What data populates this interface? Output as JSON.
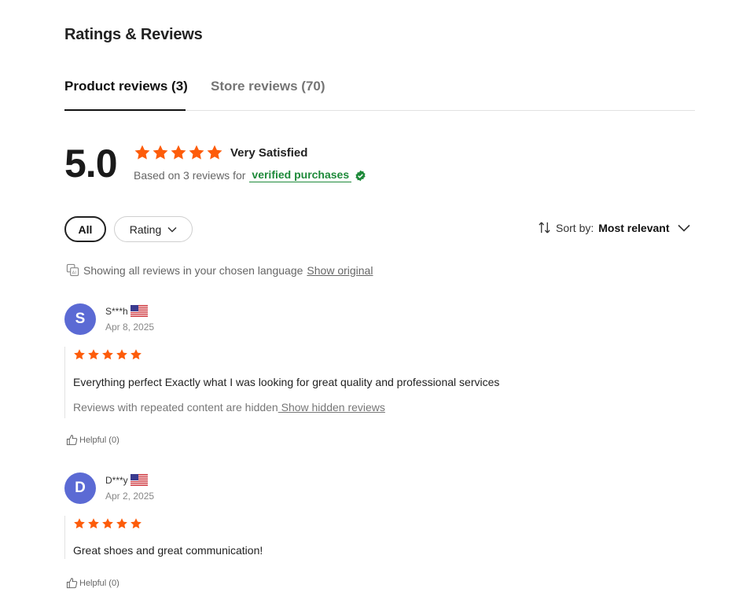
{
  "section": {
    "title": "Ratings & Reviews"
  },
  "tabs": [
    {
      "label": "Product reviews (3)",
      "active": true
    },
    {
      "label": "Store reviews (70)",
      "active": false
    }
  ],
  "summary": {
    "score": "5.0",
    "stars": 5,
    "satisfaction": "Very Satisfied",
    "based_on": "Based on 3 reviews for",
    "verified_label": "verified purchases"
  },
  "filters": {
    "all_label": "All",
    "rating_label": "Rating"
  },
  "sort": {
    "label": "Sort by:",
    "value": "Most relevant"
  },
  "language": {
    "notice": "Showing all reviews in your chosen language",
    "link": "Show original"
  },
  "reviews": [
    {
      "initial": "S",
      "name": "S***h",
      "country_flag": "us-flag",
      "date": "Apr 8, 2025",
      "stars": 5,
      "text": "Everything perfect Exactly what I was looking for great quality and professional services",
      "hidden_notice": "Reviews with repeated content are hidden",
      "hidden_link": " Show hidden reviews",
      "helpful": "Helpful (0)"
    },
    {
      "initial": "D",
      "name": "D***y",
      "country_flag": "us-flag",
      "date": "Apr 2, 2025",
      "stars": 5,
      "text": "Great shoes and great communication!",
      "helpful": "Helpful (0)"
    }
  ],
  "colors": {
    "star": "#fd5c0a",
    "verified": "#1e8a3a",
    "avatar": "#5b6ad4"
  }
}
